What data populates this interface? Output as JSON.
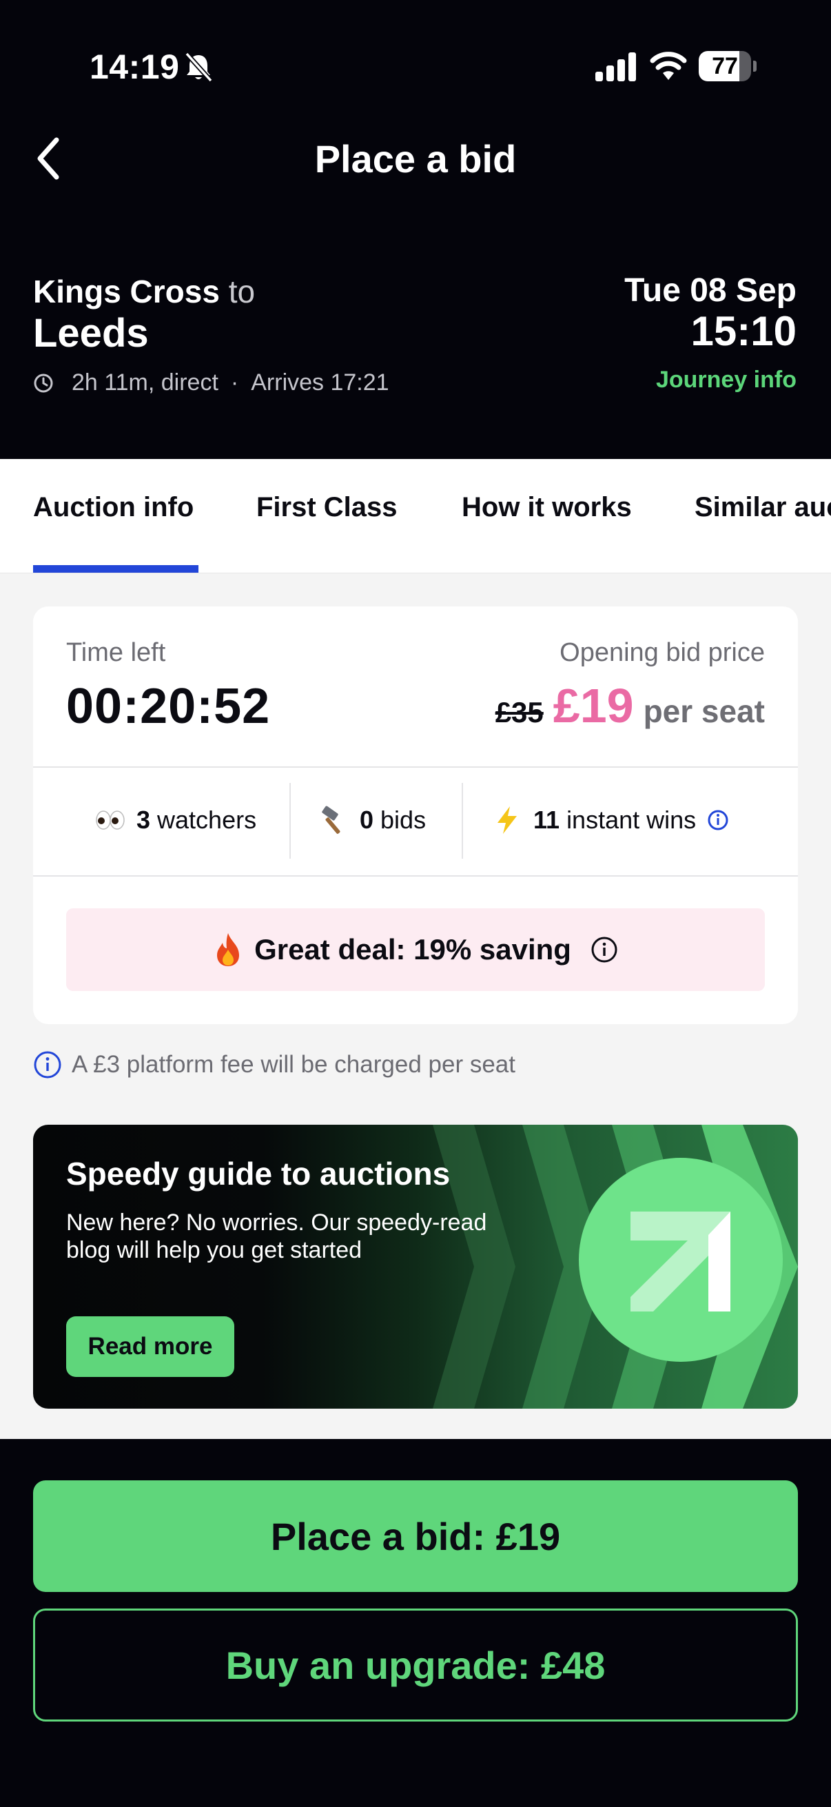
{
  "status_bar": {
    "time": "14:19",
    "battery_level": "77",
    "battery_fraction": 0.77,
    "icons": [
      "bell-off-icon",
      "signal-icon",
      "wifi-icon",
      "battery-icon"
    ]
  },
  "header": {
    "title": "Place a bid",
    "back_icon": "chevron-left-icon"
  },
  "journey": {
    "origin": "Kings Cross",
    "to_word": "to",
    "destination": "Leeds",
    "duration": "2h 11m, direct",
    "separator": "·",
    "arrives": "Arrives 17:21",
    "date": "Tue 08 Sep",
    "departure_time": "15:10",
    "journey_info_link": "Journey info"
  },
  "tabs": [
    {
      "label": "Auction info",
      "active": true
    },
    {
      "label": "First Class",
      "active": false
    },
    {
      "label": "How it works",
      "active": false
    },
    {
      "label": "Similar auctions",
      "active": false
    }
  ],
  "auction": {
    "time_left_label": "Time left",
    "time_left": "00:20:52",
    "opening_bid_label": "Opening bid price",
    "original_price": "£35",
    "current_price": "£19",
    "price_unit": "per seat",
    "stats": {
      "watchers_count": "3",
      "watchers_label": "watchers",
      "bids_count": "0",
      "bids_label": "bids",
      "instant_wins_count": "11",
      "instant_wins_label": "instant wins"
    },
    "deal_text": "Great deal: 19% saving"
  },
  "fee_note": "A £3 platform fee will be charged per seat",
  "promo": {
    "title": "Speedy guide to auctions",
    "body": "New here? No worries. Our speedy-read blog will help you get started",
    "button": "Read more"
  },
  "actions": {
    "place_bid": "Place a bid: £19",
    "buy_upgrade": "Buy an upgrade: £48"
  },
  "colors": {
    "brand_green": "#5fd67b",
    "price_pink": "#ea6aa4",
    "tab_indicator": "#2246d8",
    "header_bg": "#04040b"
  }
}
